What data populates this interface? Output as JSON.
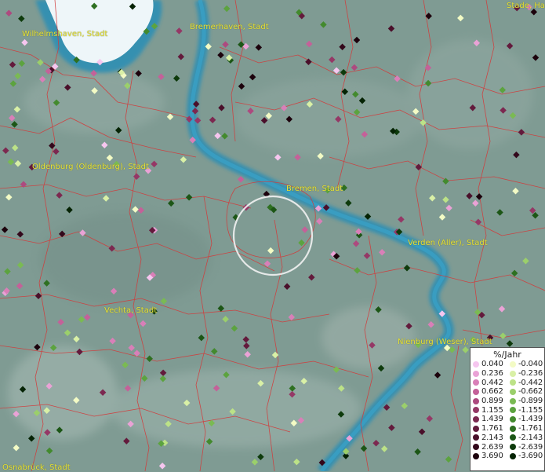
{
  "map": {
    "cities": [
      {
        "id": "wilhelmshaven",
        "label": "Wilhelmshaven, Stadt"
      },
      {
        "id": "bremerhaven",
        "label": "Bremerhaven, Stadt"
      },
      {
        "id": "stade",
        "label": "Stade, Ha"
      },
      {
        "id": "oldenburg",
        "label": "Oldenburg (Oldenburg), Stadt"
      },
      {
        "id": "bremen",
        "label": "Bremen, Stadt"
      },
      {
        "id": "verden",
        "label": "Verden (Aller), Stadt"
      },
      {
        "id": "vechta",
        "label": "Vechta, Stadt"
      },
      {
        "id": "nienburg",
        "label": "Nienburg (Weser), Stadt"
      },
      {
        "id": "osnabrueck",
        "label": "Osnabrück, Stadt"
      }
    ],
    "colors": {
      "land": "#7f9b93",
      "river": "#2e8fb4",
      "ice": "#e9f3f7",
      "borders": "#d23b3b",
      "city_label": "#e8e23a",
      "selection_ring": "#ffffff"
    }
  },
  "legend": {
    "title": "%/Jahr",
    "positive": [
      {
        "value": "0.040",
        "color": "#f6c6ef"
      },
      {
        "value": "0.236",
        "color": "#eaa2d6"
      },
      {
        "value": "0.442",
        "color": "#d97fb8"
      },
      {
        "value": "0.662",
        "color": "#c46199"
      },
      {
        "value": "0.899",
        "color": "#ad4a7f"
      },
      {
        "value": "1.155",
        "color": "#953866"
      },
      {
        "value": "1.439",
        "color": "#7c2850"
      },
      {
        "value": "1.761",
        "color": "#631a3c"
      },
      {
        "value": "2.143",
        "color": "#4a0f2a"
      },
      {
        "value": "2.639",
        "color": "#33081b"
      },
      {
        "value": "3.690",
        "color": "#1c020c"
      }
    ],
    "negative": [
      {
        "value": "-0.040",
        "color": "#f3fbc5"
      },
      {
        "value": "-0.236",
        "color": "#d9f0a6"
      },
      {
        "value": "-0.442",
        "color": "#bce287"
      },
      {
        "value": "-0.662",
        "color": "#9bcf6b"
      },
      {
        "value": "-0.899",
        "color": "#7aba53"
      },
      {
        "value": "-1.155",
        "color": "#5ca33f"
      },
      {
        "value": "-1.439",
        "color": "#438a2e"
      },
      {
        "value": "-1.761",
        "color": "#2e7021"
      },
      {
        "value": "-2.143",
        "color": "#1c5616"
      },
      {
        "value": "-2.639",
        "color": "#0e3b0c"
      },
      {
        "value": "-3.690",
        "color": "#052304"
      }
    ]
  }
}
